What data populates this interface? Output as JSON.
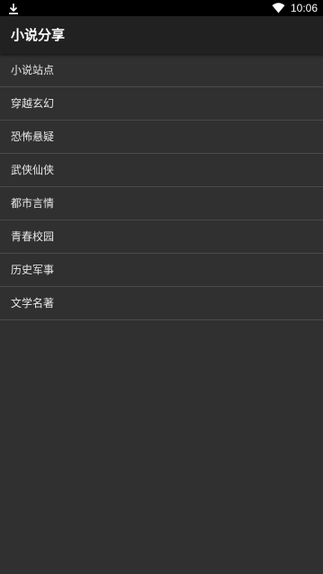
{
  "status_bar": {
    "time": "10:06",
    "left_icon": "download-icon",
    "right_icon": "wifi-icon"
  },
  "app_bar": {
    "title": "小说分享"
  },
  "categories": [
    {
      "label": "小说站点"
    },
    {
      "label": "穿越玄幻"
    },
    {
      "label": "恐怖悬疑"
    },
    {
      "label": "武侠仙侠"
    },
    {
      "label": "都市言情"
    },
    {
      "label": "青春校园"
    },
    {
      "label": "历史军事"
    },
    {
      "label": "文学名著"
    }
  ],
  "colors": {
    "background": "#303030",
    "app_bar": "#212121",
    "status_bar": "#000000",
    "divider": "#4a4a4a",
    "text": "#e8e8e8"
  }
}
